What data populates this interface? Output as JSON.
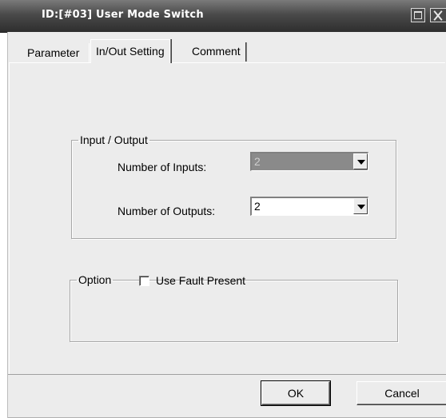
{
  "window": {
    "title": "ID:[#03] User Mode Switch"
  },
  "tabs": [
    {
      "label": "Parameter",
      "active": false
    },
    {
      "label": "In/Out Setting",
      "active": true
    },
    {
      "label": "Comment",
      "active": false
    }
  ],
  "io_group": {
    "legend": "Input / Output",
    "inputs_label": "Number of Inputs:",
    "inputs_value": "2",
    "inputs_disabled": true,
    "outputs_label": "Number of Outputs:",
    "outputs_value": "2"
  },
  "option_group": {
    "legend": "Option",
    "fault_label": "Use Fault Present",
    "fault_checked": false
  },
  "buttons": {
    "ok": "OK",
    "cancel": "Cancel"
  },
  "icons": {
    "maximize": "maximize-icon",
    "close": "close-icon",
    "dropdown": "chevron-down-icon"
  },
  "colors": {
    "titlebar": "#3a3a3a",
    "face": "#ececec",
    "disabled_field": "#8a8a8a"
  }
}
